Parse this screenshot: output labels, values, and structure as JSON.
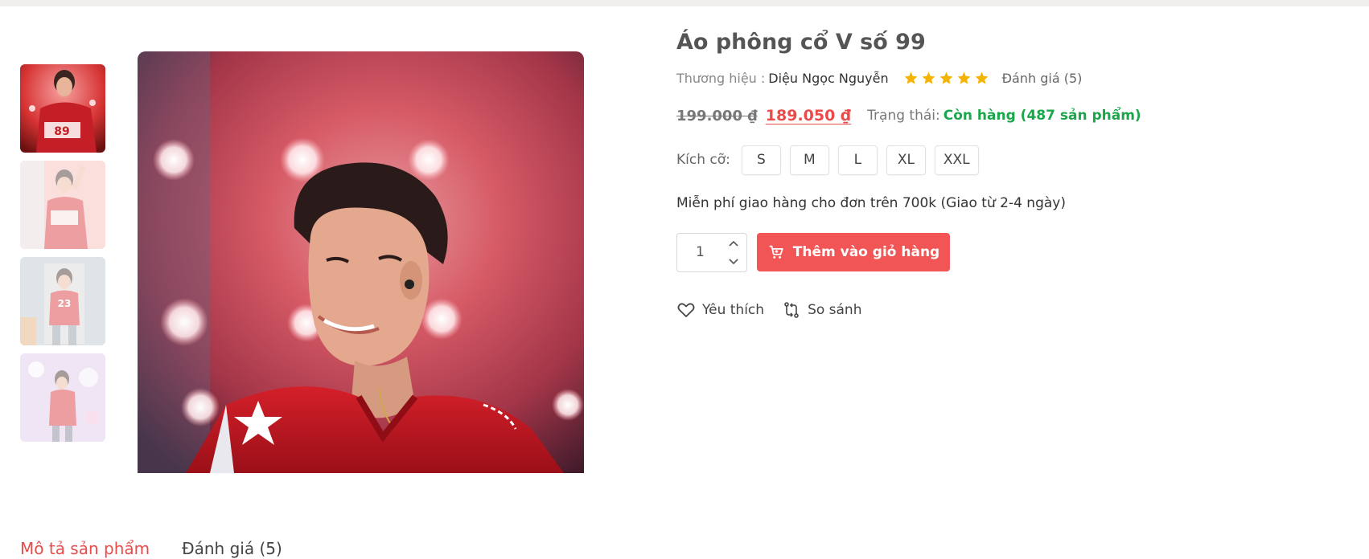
{
  "product": {
    "title": "Áo phông cổ V số 99",
    "brand_label": "Thương hiệu :",
    "brand_name": "Diệu Ngọc Nguyễn",
    "rating": 5,
    "rating_max": 5,
    "rating_text": "Đánh giá (5)",
    "price_old": "199.000 ₫",
    "price_new": "189.050 ₫",
    "status_label": "Trạng thái:",
    "status_value": "Còn hàng (487 sản phẩm)",
    "size_label": "Kích cỡ:",
    "sizes": [
      "S",
      "M",
      "L",
      "XL",
      "XXL"
    ],
    "shipping_note": "Miễn phí giao hàng cho đơn trên 700k (Giao từ 2-4 ngày)",
    "quantity": "1",
    "add_to_cart_label": "Thêm vào giỏ hàng",
    "wishlist_label": "Yêu thích",
    "compare_label": "So sánh"
  },
  "gallery": {
    "thumbnail_count": 4,
    "selected_index": 0
  },
  "tabs": [
    {
      "label": "Mô tả sản phẩm",
      "active": true
    },
    {
      "label": "Đánh giá (5)",
      "active": false
    }
  ],
  "colors": {
    "accent_red": "#f25555",
    "price_red": "#e94b4b",
    "stock_green": "#1aa64a",
    "star_gold": "#f5b301"
  },
  "icons": {
    "star": "star-icon",
    "cart": "cart-icon",
    "wishlist": "heart-icon",
    "compare": "compare-icon",
    "qty_up": "chevron-up-icon",
    "qty_down": "chevron-down-icon"
  }
}
